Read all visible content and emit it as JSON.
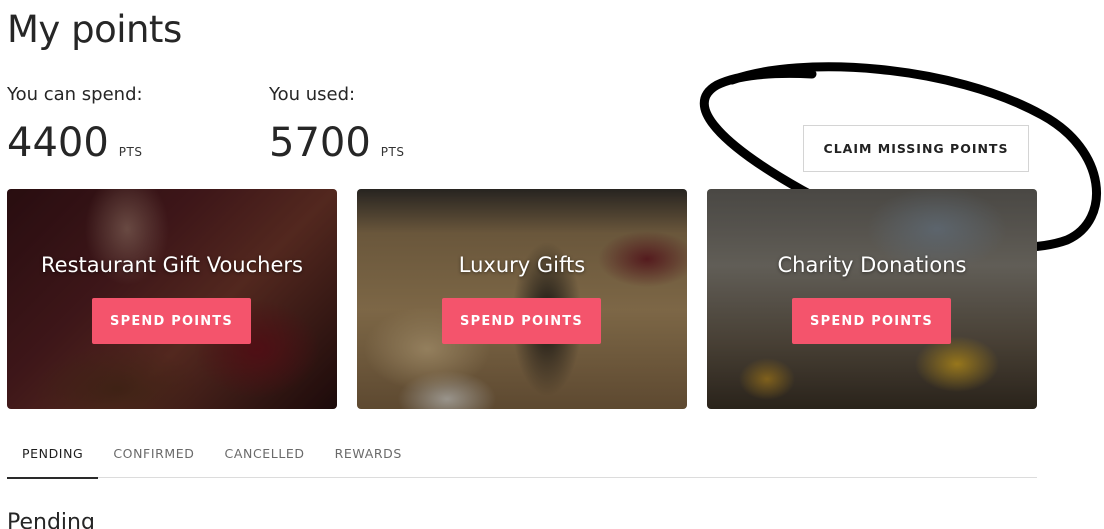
{
  "page": {
    "title": "My points"
  },
  "stats": {
    "spend": {
      "label": "You can spend:",
      "value": "4400",
      "unit": "PTS"
    },
    "used": {
      "label": "You used:",
      "value": "5700",
      "unit": "PTS"
    }
  },
  "claim_button": {
    "label": "CLAIM MISSING POINTS"
  },
  "cards": [
    {
      "title": "Restaurant Gift Vouchers",
      "button": "SPEND POINTS"
    },
    {
      "title": "Luxury Gifts",
      "button": "SPEND POINTS"
    },
    {
      "title": "Charity Donations",
      "button": "SPEND POINTS"
    }
  ],
  "tabs": [
    {
      "label": "PENDING",
      "active": true
    },
    {
      "label": "CONFIRMED",
      "active": false
    },
    {
      "label": "CANCELLED",
      "active": false
    },
    {
      "label": "REWARDS",
      "active": false
    }
  ],
  "section": {
    "heading": "Pending"
  },
  "colors": {
    "accent": "#f4546c",
    "text": "#262626",
    "annotation": "#000000"
  }
}
